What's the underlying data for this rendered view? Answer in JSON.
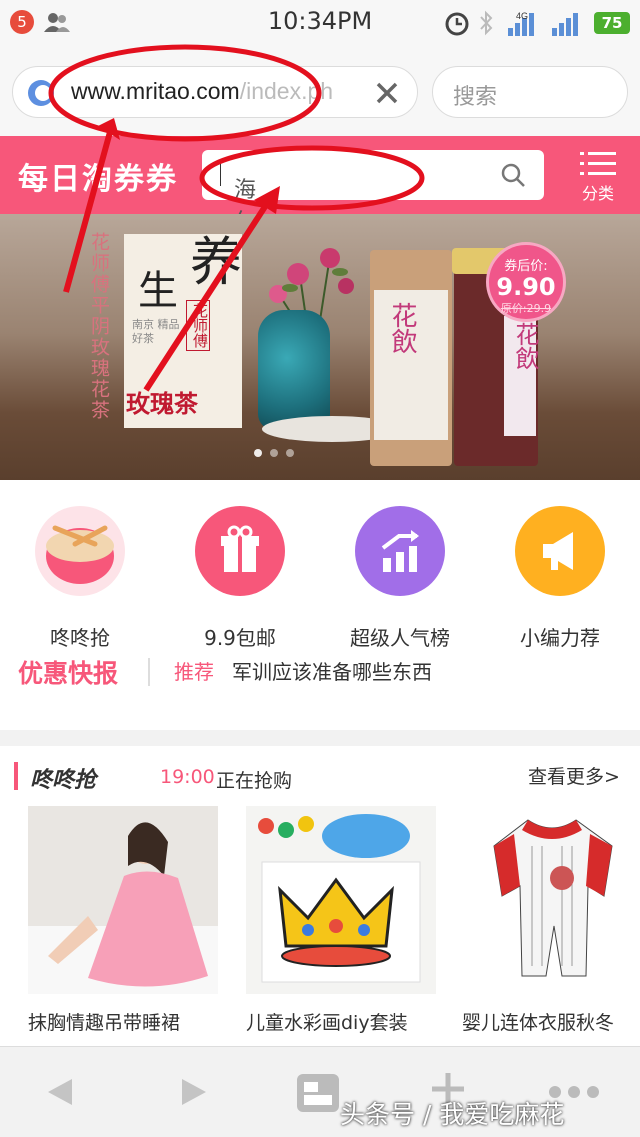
{
  "status_bar": {
    "notification_count": "5",
    "time": "10:34PM",
    "network_label": "4G",
    "battery": "75"
  },
  "browser": {
    "url_main": "www.mritao.com",
    "url_rest": "/index.ph",
    "search_placeholder": "搜索"
  },
  "site_header": {
    "logo": "每日淘券券",
    "search_value": "海尔除螨仪",
    "category_label": "分类",
    "accent_color": "#f7577a"
  },
  "banner": {
    "vertical_text": "花师傅平阴玫瑰花茶",
    "big_char_1": "生",
    "big_char_2": "养",
    "stamp": "花师傅",
    "small_text": "南京 精品好茶",
    "product_title": "玫瑰茶",
    "can_label": "花飲",
    "price_label": "券后价:",
    "price": "9.90",
    "original_price": "原价:29.9"
  },
  "quick_links": [
    {
      "label": "咚咚抢",
      "icon": "drum-icon",
      "color": "#f7577a"
    },
    {
      "label": "9.9包邮",
      "icon": "gift-icon",
      "color": "#f7577a"
    },
    {
      "label": "超级人气榜",
      "icon": "chart-up-icon",
      "color": "#a16ee8"
    },
    {
      "label": "小编力荐",
      "icon": "megaphone-icon",
      "color": "#ffb020"
    }
  ],
  "flash_news": {
    "title": "优惠快报",
    "tag": "推荐",
    "text": "军训应该准备哪些东西"
  },
  "deals": {
    "title": "咚咚抢",
    "time": "19:00",
    "status": "正在抢购",
    "more": "查看更多>",
    "products": [
      {
        "name": "抹胸情趣吊带睡裙"
      },
      {
        "name": "儿童水彩画diy套装"
      },
      {
        "name": "婴儿连体衣服秋冬"
      }
    ]
  },
  "watermark": "头条号 / 我爱吃麻花"
}
